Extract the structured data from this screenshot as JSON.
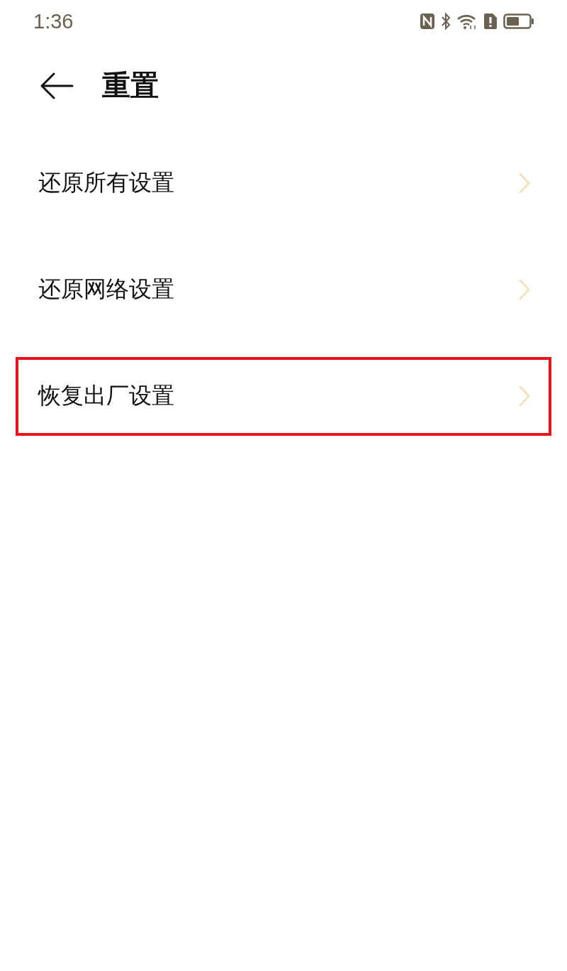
{
  "status_bar": {
    "time": "1:36"
  },
  "header": {
    "title": "重置"
  },
  "items": [
    {
      "label": "还原所有设置",
      "highlighted": false
    },
    {
      "label": "还原网络设置",
      "highlighted": false
    },
    {
      "label": "恢复出厂设置",
      "highlighted": true
    }
  ]
}
